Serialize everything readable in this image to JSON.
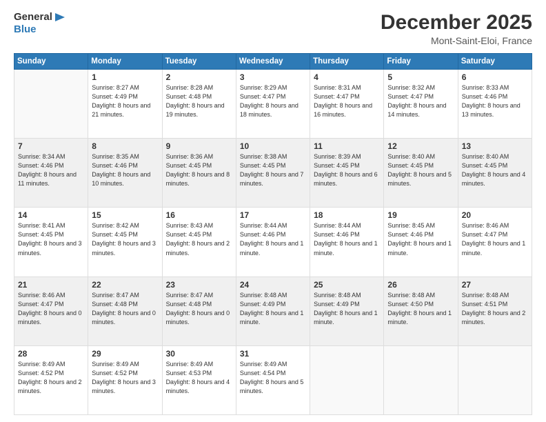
{
  "header": {
    "logo_general": "General",
    "logo_blue": "Blue",
    "month": "December 2025",
    "location": "Mont-Saint-Eloi, France"
  },
  "days_of_week": [
    "Sunday",
    "Monday",
    "Tuesday",
    "Wednesday",
    "Thursday",
    "Friday",
    "Saturday"
  ],
  "weeks": [
    [
      {
        "day": "",
        "empty": true
      },
      {
        "day": "1",
        "sunrise": "8:27 AM",
        "sunset": "4:49 PM",
        "daylight": "8 hours and 21 minutes."
      },
      {
        "day": "2",
        "sunrise": "8:28 AM",
        "sunset": "4:48 PM",
        "daylight": "8 hours and 19 minutes."
      },
      {
        "day": "3",
        "sunrise": "8:29 AM",
        "sunset": "4:47 PM",
        "daylight": "8 hours and 18 minutes."
      },
      {
        "day": "4",
        "sunrise": "8:31 AM",
        "sunset": "4:47 PM",
        "daylight": "8 hours and 16 minutes."
      },
      {
        "day": "5",
        "sunrise": "8:32 AM",
        "sunset": "4:47 PM",
        "daylight": "8 hours and 14 minutes."
      },
      {
        "day": "6",
        "sunrise": "8:33 AM",
        "sunset": "4:46 PM",
        "daylight": "8 hours and 13 minutes."
      }
    ],
    [
      {
        "day": "7",
        "sunrise": "8:34 AM",
        "sunset": "4:46 PM",
        "daylight": "8 hours and 11 minutes."
      },
      {
        "day": "8",
        "sunrise": "8:35 AM",
        "sunset": "4:46 PM",
        "daylight": "8 hours and 10 minutes."
      },
      {
        "day": "9",
        "sunrise": "8:36 AM",
        "sunset": "4:45 PM",
        "daylight": "8 hours and 8 minutes."
      },
      {
        "day": "10",
        "sunrise": "8:38 AM",
        "sunset": "4:45 PM",
        "daylight": "8 hours and 7 minutes."
      },
      {
        "day": "11",
        "sunrise": "8:39 AM",
        "sunset": "4:45 PM",
        "daylight": "8 hours and 6 minutes."
      },
      {
        "day": "12",
        "sunrise": "8:40 AM",
        "sunset": "4:45 PM",
        "daylight": "8 hours and 5 minutes."
      },
      {
        "day": "13",
        "sunrise": "8:40 AM",
        "sunset": "4:45 PM",
        "daylight": "8 hours and 4 minutes."
      }
    ],
    [
      {
        "day": "14",
        "sunrise": "8:41 AM",
        "sunset": "4:45 PM",
        "daylight": "8 hours and 3 minutes."
      },
      {
        "day": "15",
        "sunrise": "8:42 AM",
        "sunset": "4:45 PM",
        "daylight": "8 hours and 3 minutes."
      },
      {
        "day": "16",
        "sunrise": "8:43 AM",
        "sunset": "4:45 PM",
        "daylight": "8 hours and 2 minutes."
      },
      {
        "day": "17",
        "sunrise": "8:44 AM",
        "sunset": "4:46 PM",
        "daylight": "8 hours and 1 minute."
      },
      {
        "day": "18",
        "sunrise": "8:44 AM",
        "sunset": "4:46 PM",
        "daylight": "8 hours and 1 minute."
      },
      {
        "day": "19",
        "sunrise": "8:45 AM",
        "sunset": "4:46 PM",
        "daylight": "8 hours and 1 minute."
      },
      {
        "day": "20",
        "sunrise": "8:46 AM",
        "sunset": "4:47 PM",
        "daylight": "8 hours and 1 minute."
      }
    ],
    [
      {
        "day": "21",
        "sunrise": "8:46 AM",
        "sunset": "4:47 PM",
        "daylight": "8 hours and 0 minutes."
      },
      {
        "day": "22",
        "sunrise": "8:47 AM",
        "sunset": "4:48 PM",
        "daylight": "8 hours and 0 minutes."
      },
      {
        "day": "23",
        "sunrise": "8:47 AM",
        "sunset": "4:48 PM",
        "daylight": "8 hours and 0 minutes."
      },
      {
        "day": "24",
        "sunrise": "8:48 AM",
        "sunset": "4:49 PM",
        "daylight": "8 hours and 1 minute."
      },
      {
        "day": "25",
        "sunrise": "8:48 AM",
        "sunset": "4:49 PM",
        "daylight": "8 hours and 1 minute."
      },
      {
        "day": "26",
        "sunrise": "8:48 AM",
        "sunset": "4:50 PM",
        "daylight": "8 hours and 1 minute."
      },
      {
        "day": "27",
        "sunrise": "8:48 AM",
        "sunset": "4:51 PM",
        "daylight": "8 hours and 2 minutes."
      }
    ],
    [
      {
        "day": "28",
        "sunrise": "8:49 AM",
        "sunset": "4:52 PM",
        "daylight": "8 hours and 2 minutes."
      },
      {
        "day": "29",
        "sunrise": "8:49 AM",
        "sunset": "4:52 PM",
        "daylight": "8 hours and 3 minutes."
      },
      {
        "day": "30",
        "sunrise": "8:49 AM",
        "sunset": "4:53 PM",
        "daylight": "8 hours and 4 minutes."
      },
      {
        "day": "31",
        "sunrise": "8:49 AM",
        "sunset": "4:54 PM",
        "daylight": "8 hours and 5 minutes."
      },
      {
        "day": "",
        "empty": true
      },
      {
        "day": "",
        "empty": true
      },
      {
        "day": "",
        "empty": true
      }
    ]
  ],
  "labels": {
    "sunrise": "Sunrise:",
    "sunset": "Sunset:",
    "daylight": "Daylight:"
  }
}
